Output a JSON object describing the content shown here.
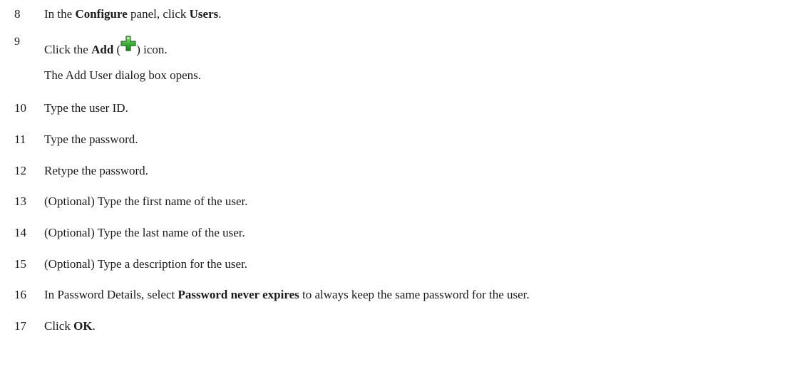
{
  "steps": [
    {
      "number": "8",
      "parts": [
        "In the ",
        "Configure",
        " panel, click ",
        "Users",
        "."
      ]
    },
    {
      "number": "9",
      "parts": [
        "Click the ",
        "Add",
        " (",
        ") icon."
      ],
      "icon": "add-plus-icon",
      "icon_color": "#3db43a",
      "note": "The Add User dialog box opens."
    },
    {
      "number": "10",
      "text": "Type the user ID."
    },
    {
      "number": "11",
      "text": "Type the password."
    },
    {
      "number": "12",
      "text": "Retype the password."
    },
    {
      "number": "13",
      "text": "(Optional) Type the first name of the user."
    },
    {
      "number": "14",
      "text": "(Optional) Type the last name of the user."
    },
    {
      "number": "15",
      "text": "(Optional) Type a description for the user."
    },
    {
      "number": "16",
      "parts": [
        "In Password Details, select ",
        "Password never expires",
        " to always keep the same password for the user."
      ]
    },
    {
      "number": "17",
      "parts": [
        "Click ",
        "OK",
        "."
      ]
    }
  ]
}
